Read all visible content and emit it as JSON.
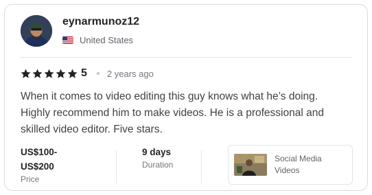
{
  "reviewer": {
    "username": "eynarmunoz12",
    "country": "United States",
    "country_flag": "us-flag-icon"
  },
  "review": {
    "rating": "5",
    "rating_stars": 5,
    "time_ago": "2 years ago",
    "text": "When it comes to video editing this guy knows what he’s doing. Highly recommend him to make videos. He is a professional and skilled video editor. Five stars."
  },
  "meta": {
    "price_line1": "US$100-",
    "price_line2": "US$200",
    "price_label": "Price",
    "duration_value": "9 days",
    "duration_label": "Duration"
  },
  "gig": {
    "title_line1": "Social Media",
    "title_line2": "Videos"
  },
  "colors": {
    "star": "#222325",
    "text": "#404145",
    "muted": "#74767e",
    "border": "#dadbdd"
  }
}
